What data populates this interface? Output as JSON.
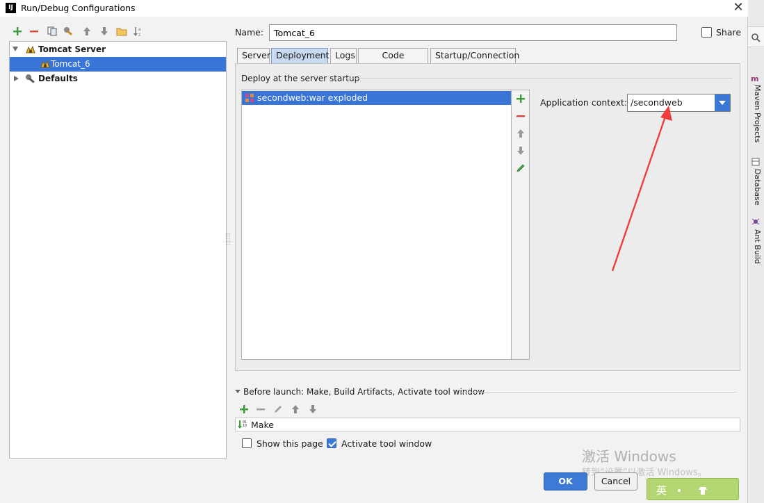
{
  "window": {
    "title": "Run/Debug Configurations",
    "app_icon_text": "IJ"
  },
  "left_toolbar": {
    "icons": [
      "add-icon",
      "remove-icon",
      "copy-icon",
      "edit-defaults-icon",
      "move-up-icon",
      "move-down-icon",
      "folder-icon",
      "sort-icon"
    ]
  },
  "tree": {
    "items": [
      {
        "label": "Tomcat Server",
        "level": 0,
        "expanded": true,
        "bold": true
      },
      {
        "label": "Tomcat_6",
        "level": 1,
        "selected": true
      },
      {
        "label": "Defaults",
        "level": 0,
        "expanded": false,
        "bold": true
      }
    ]
  },
  "name_field": {
    "label": "Name:",
    "value": "Tomcat_6"
  },
  "share": {
    "label": "Share",
    "checked": false
  },
  "tabs": [
    {
      "label": "Server"
    },
    {
      "label": "Deployment",
      "active": true
    },
    {
      "label": "Logs"
    },
    {
      "label": "Code Coverage"
    },
    {
      "label": "Startup/Connection"
    }
  ],
  "deployment": {
    "section_label": "Deploy at the server startup",
    "items": [
      "secondweb:war exploded"
    ],
    "context_label": "Application context:",
    "context_value": "/secondweb"
  },
  "before_launch": {
    "label": "Before launch: Make, Build Artifacts, Activate tool window",
    "items": [
      "Make"
    ]
  },
  "options": {
    "show_page_label": "Show this page",
    "show_page_checked": false,
    "activate_label": "Activate tool window",
    "activate_checked": true
  },
  "buttons": {
    "ok": "OK",
    "cancel": "Cancel"
  },
  "watermark": {
    "line1": "激活 Windows",
    "line2": "转到“设置”以激活 Windows。"
  },
  "ime": {
    "char": "英"
  },
  "side_panel": {
    "tabs": [
      "Maven Projects",
      "Database",
      "Ant Build"
    ]
  },
  "colors": {
    "selection": "#3875d7",
    "primary_button": "#3d7ad6",
    "add_green": "#3a9a3a",
    "remove_red": "#d9423a",
    "annotation_arrow": "#f03c3c"
  }
}
